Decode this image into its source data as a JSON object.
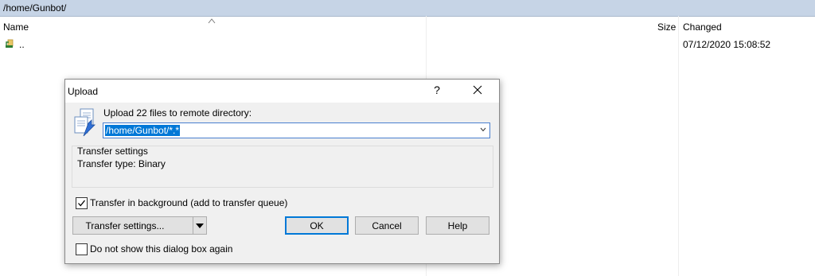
{
  "path": "/home/Gunbot/",
  "file_list": {
    "columns": {
      "name": "Name",
      "size": "Size",
      "changed": "Changed"
    },
    "rows": [
      {
        "name": "..",
        "size": "",
        "changed": "07/12/2020 15:08:52",
        "icon": "parent-folder-icon"
      }
    ]
  },
  "dialog": {
    "title": "Upload",
    "help_glyph": "?",
    "upload_label": "Upload 22 files to remote directory:",
    "target_value": "/home/Gunbot/*.*",
    "group_title": "Transfer settings",
    "transfer_type": "Transfer type: Binary",
    "background_label": "Transfer in background (add to transfer queue)",
    "background_checked": true,
    "transfer_settings_button": "Transfer settings...",
    "ok_button": "OK",
    "cancel_button": "Cancel",
    "help_button": "Help",
    "noshow_label": "Do not show this dialog box again",
    "noshow_checked": false
  },
  "colors": {
    "pathbar": "#c6d4e6",
    "selection": "#0078d7",
    "dialog_bg": "#f0f0f0"
  }
}
